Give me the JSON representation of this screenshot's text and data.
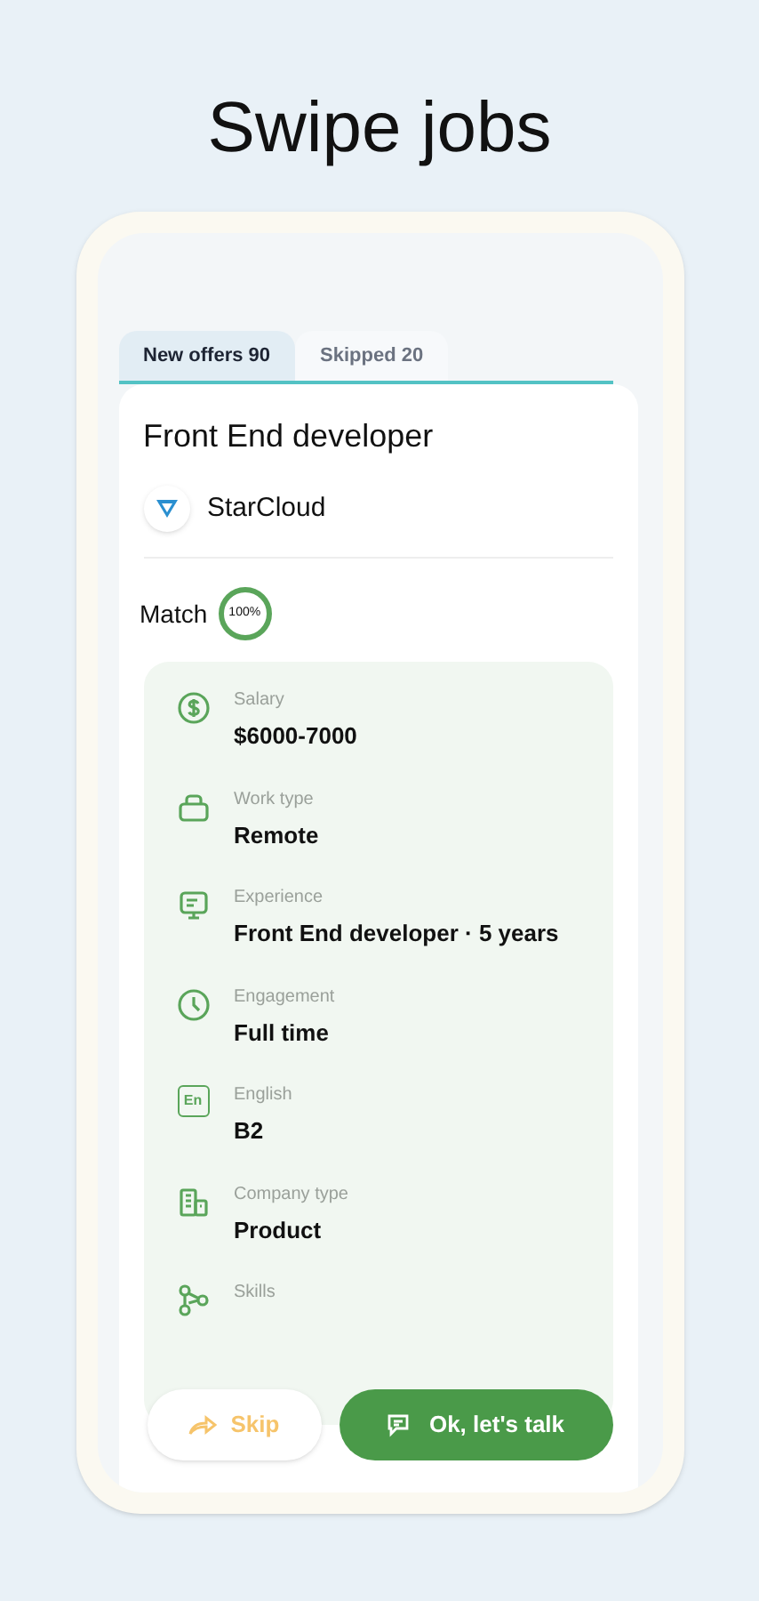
{
  "headline": "Swipe jobs",
  "tabs": [
    {
      "label": "New offers 90",
      "selected": true
    },
    {
      "label": "Skipped 20",
      "selected": false
    }
  ],
  "job": {
    "title": "Front End developer",
    "company": "StarCloud",
    "match_label": "Match",
    "match_value": "100%"
  },
  "details": [
    {
      "kind": "salary",
      "label": "Salary",
      "value": "$6000-7000"
    },
    {
      "kind": "work",
      "label": "Work type",
      "value": "Remote"
    },
    {
      "kind": "experience",
      "label": "Experience",
      "value": "Front End developer · 5 years"
    },
    {
      "kind": "engagement",
      "label": "Engagement",
      "value": "Full time"
    },
    {
      "kind": "language",
      "label": "English",
      "value": "B2",
      "badge": "En"
    },
    {
      "kind": "company",
      "label": "Company type",
      "value": "Product"
    },
    {
      "kind": "skills",
      "label": "Skills"
    }
  ],
  "actions": [
    {
      "kind": "skip",
      "label": "Skip"
    },
    {
      "kind": "talk",
      "label": "Ok, let's talk"
    }
  ]
}
